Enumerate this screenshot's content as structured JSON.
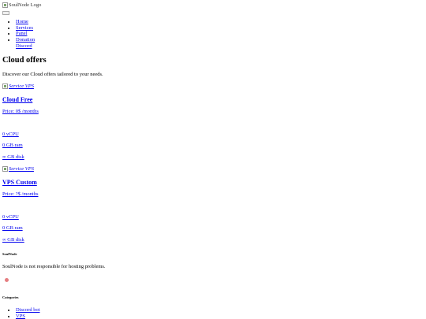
{
  "header": {
    "logo_alt": "SoulNode Logo",
    "nav": [
      "Home",
      "Services",
      "Panel",
      "Donation",
      "Discord"
    ]
  },
  "main": {
    "title": "Cloud offers",
    "description": "Discover our Cloud offers tailored to your needs.",
    "cards": [
      {
        "image_alt": "Service VPS",
        "title": "Cloud Free",
        "price": "Price: 0$ /months",
        "cpu": "0 vCPU",
        "ram": "0 GB ram",
        "disk": "∞ GB disk"
      },
      {
        "image_alt": "Service VPS",
        "title": "VPS Custom",
        "price": "Price: ?$ /months",
        "cpu": "0 vCPU",
        "ram": "0 GB ram",
        "disk": "∞ GB disk"
      }
    ]
  },
  "footer": {
    "brand": "SoulNode",
    "note": "SoulNode is not responsible for hosting problems.",
    "categories_heading": "Categories",
    "categories": [
      "Discord bot",
      "VPS"
    ]
  }
}
